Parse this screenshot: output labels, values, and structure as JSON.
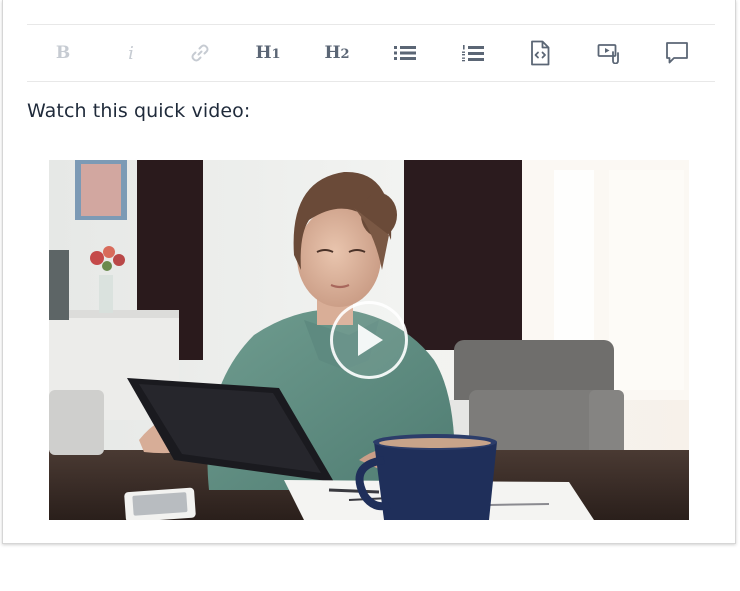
{
  "toolbar": {
    "buttons": [
      {
        "id": "bold",
        "label": "B",
        "icon": "bold-icon",
        "enabled": false
      },
      {
        "id": "italic",
        "label": "i",
        "icon": "italic-icon",
        "enabled": false
      },
      {
        "id": "link",
        "label": "",
        "icon": "link-icon",
        "enabled": false
      },
      {
        "id": "h1",
        "label": "H1",
        "icon": "heading-1-icon",
        "enabled": true
      },
      {
        "id": "h2",
        "label": "H2",
        "icon": "heading-2-icon",
        "enabled": true
      },
      {
        "id": "bullet-list",
        "label": "",
        "icon": "bulleted-list-icon",
        "enabled": true
      },
      {
        "id": "numbered-list",
        "label": "",
        "icon": "numbered-list-icon",
        "enabled": true
      },
      {
        "id": "code",
        "label": "",
        "icon": "code-file-icon",
        "enabled": true
      },
      {
        "id": "media",
        "label": "",
        "icon": "embed-media-icon",
        "enabled": true
      },
      {
        "id": "comment",
        "label": "",
        "icon": "comment-icon",
        "enabled": true
      }
    ],
    "h1_main": "H",
    "h1_sub": "1",
    "h2_main": "H",
    "h2_sub": "2"
  },
  "content": {
    "intro_text": "Watch this quick video:"
  },
  "video": {
    "thumbnail": "woman-with-tablet-thumbnail",
    "play_icon": "play-icon"
  },
  "colors": {
    "icon_active": "#5b6675",
    "icon_disabled": "#c6cbd2",
    "text": "#1f2a3a",
    "border": "#e8e8e8"
  }
}
